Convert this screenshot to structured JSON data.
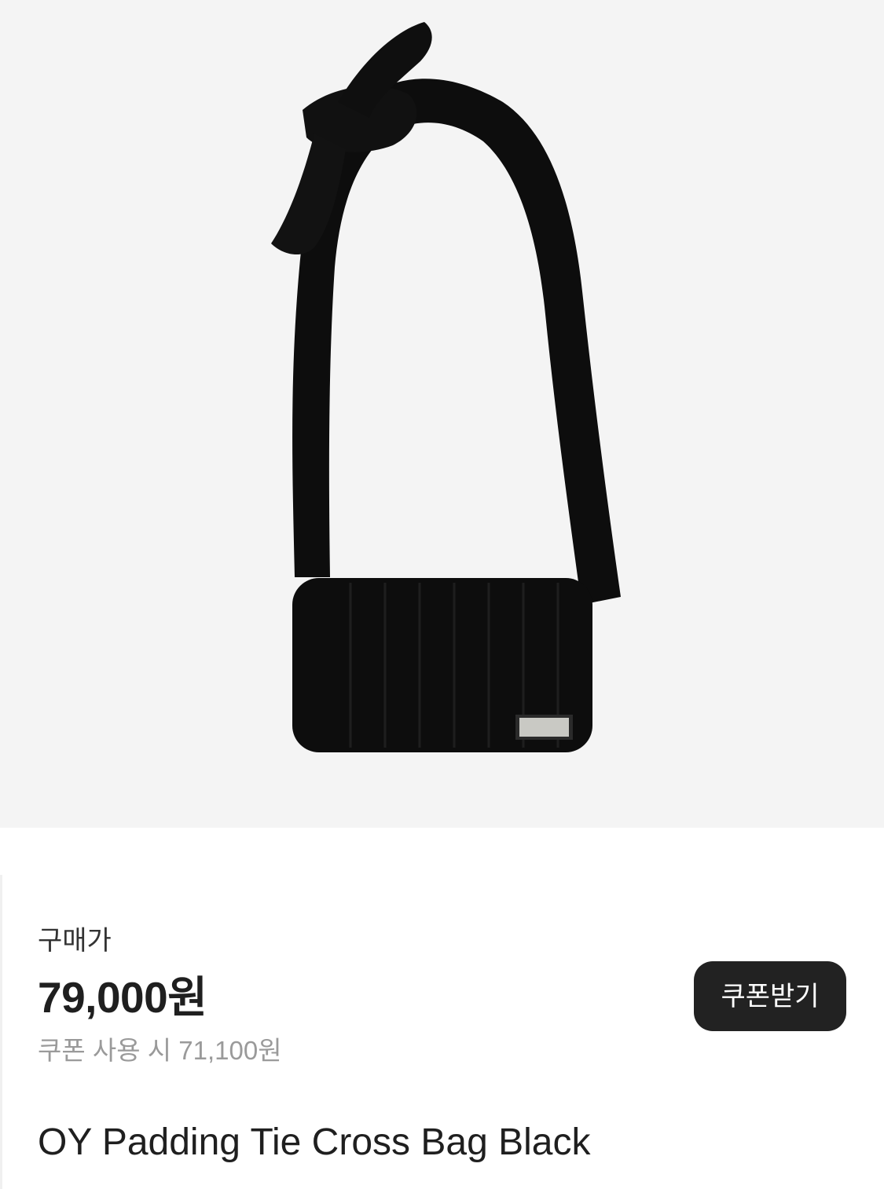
{
  "product": {
    "image_alt": "OY Padding Tie Cross Bag Black",
    "image_background": "#f4f4f4",
    "bag_color": "#0d0d0d",
    "name": "OY Padding Tie Cross Bag Black"
  },
  "pricing": {
    "label": "구매가",
    "price": "79,000원",
    "coupon_price_text": "쿠폰 사용 시 71,100원"
  },
  "actions": {
    "coupon_button_label": "쿠폰받기",
    "coupon_button_bg": "#222222"
  }
}
